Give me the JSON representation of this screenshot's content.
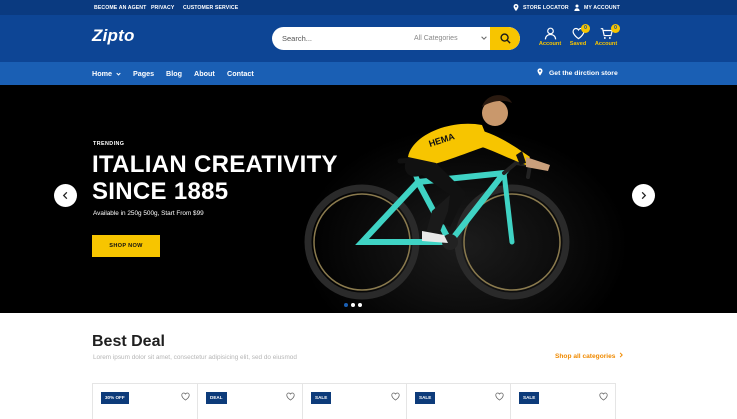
{
  "topbar": {
    "left_links": [
      "BECOME AN AGENT",
      "PRIVACY",
      "CUSTOMER SERVICE"
    ],
    "store_locator": "STORE LOCATOR",
    "my_account": "MY ACCOUNT"
  },
  "header": {
    "logo": "Zipto",
    "search_placeholder": "Search...",
    "category_select": "All Categories",
    "icons": [
      {
        "icon": "user-icon",
        "label": "Account"
      },
      {
        "icon": "heart-icon",
        "label": "Saved",
        "badge": "0"
      },
      {
        "icon": "cart-icon",
        "label": "Account",
        "badge": "0"
      }
    ]
  },
  "nav": {
    "items": [
      "Home",
      "Pages",
      "Blog",
      "About",
      "Contact"
    ],
    "direction": "Get the dirction store"
  },
  "hero": {
    "eyebrow": "TRENDING",
    "title_line1": "ITALIAN CREATIVITY",
    "title_line2": "SINCE 1885",
    "subtitle": "Available in 250g 500g, Start From $99",
    "cta": "SHOP NOW",
    "jersey_text": "HEMA",
    "slide_count": 3,
    "active_slide": 1
  },
  "best_deal": {
    "title": "Best Deal",
    "subtitle": "Lorem ipsum dolor sit amet, consectetur adipisicing elit, sed do eiusmod",
    "shop_all": "Shop all categories",
    "cards": [
      {
        "tag": "30% OFF"
      },
      {
        "tag": "DEAL"
      },
      {
        "tag": "SALE"
      },
      {
        "tag": "SALE"
      },
      {
        "tag": "SALE"
      }
    ]
  },
  "colors": {
    "topbar": "#0a3a80",
    "header": "#0d4595",
    "nav": "#1a5fb4",
    "accent_yellow": "#f7c500",
    "accent_orange": "#f08a00",
    "tag_navy": "#0d3b7a"
  }
}
